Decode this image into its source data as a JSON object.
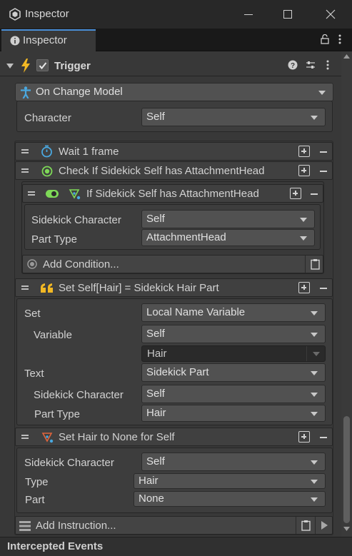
{
  "window": {
    "title": "Inspector"
  },
  "tab": {
    "label": "Inspector"
  },
  "trigger": {
    "label": "Trigger",
    "checked": true
  },
  "event": {
    "dropdown": "On Change Model",
    "character_label": "Character",
    "character_value": "Self"
  },
  "instructions": {
    "wait": {
      "label": "Wait 1 frame"
    },
    "check": {
      "label": "Check If Sidekick Self has AttachmentHead",
      "condition": {
        "label": "If Sidekick Self has AttachmentHead",
        "sidekick_label": "Sidekick Character",
        "sidekick_value": "Self",
        "part_type_label": "Part Type",
        "part_type_value": "AttachmentHead"
      },
      "add_condition": "Add Condition..."
    },
    "set": {
      "label": "Set Self[Hair] = Sidekick Hair Part",
      "set_label": "Set",
      "set_value": "Local Name Variable",
      "variable_label": "Variable",
      "variable_value": "Self",
      "variable_name": "Hair",
      "text_label": "Text",
      "text_value": "Sidekick Part",
      "sidekick_label": "Sidekick Character",
      "sidekick_value": "Self",
      "part_type_label": "Part Type",
      "part_type_value": "Hair"
    },
    "sethair": {
      "label": "Set Hair to None for Self",
      "sidekick_label": "Sidekick Character",
      "sidekick_value": "Self",
      "type_label": "Type",
      "type_value": "Hair",
      "part_label": "Part",
      "part_value": "None"
    },
    "add_instruction": "Add Instruction..."
  },
  "footer": {
    "label": "Intercepted Events"
  },
  "colors": {
    "accent": "#4a8fd8",
    "trigger_icon": "#f2b824",
    "check_icon": "#7ed957",
    "quote_icon": "#f2b824"
  }
}
